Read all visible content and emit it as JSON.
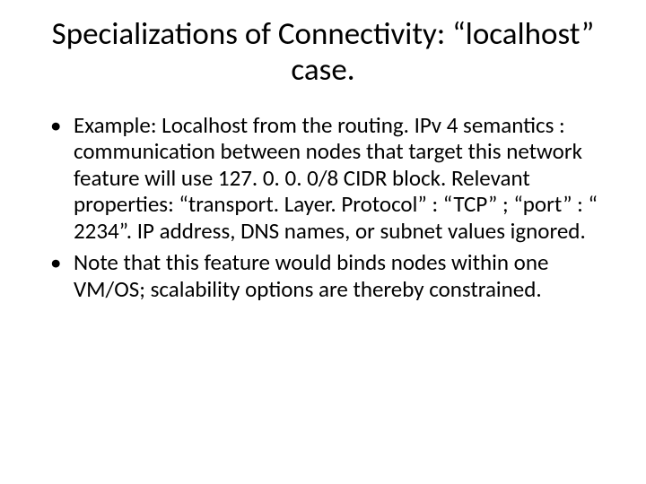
{
  "title": "Specializations of Connectivity: “localhost” case.",
  "bullets": [
    "Example: Localhost from the routing.  IPv 4 semantics : communication between nodes that target this network feature will use 127. 0. 0. 0/8 CIDR block. Relevant properties: “transport. Layer. Protocol” : “TCP” ; “port” : “ 2234”. IP address, DNS names, or subnet values ignored.",
    "Note that this feature would binds nodes within one VM/OS; scalability options are thereby constrained."
  ]
}
